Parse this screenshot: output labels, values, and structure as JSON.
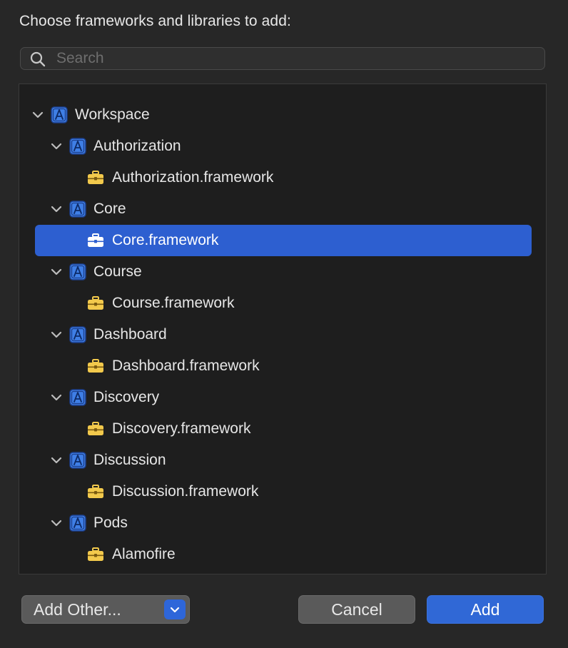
{
  "dialog": {
    "heading": "Choose frameworks and libraries to add:"
  },
  "search": {
    "placeholder": "Search",
    "value": ""
  },
  "tree": {
    "items": [
      {
        "label": "Workspace",
        "kind": "project",
        "level": 0,
        "expanded": true,
        "selected": false
      },
      {
        "label": "Authorization",
        "kind": "project",
        "level": 1,
        "expanded": true,
        "selected": false
      },
      {
        "label": "Authorization.framework",
        "kind": "framework",
        "level": 2,
        "selected": false
      },
      {
        "label": "Core",
        "kind": "project",
        "level": 1,
        "expanded": true,
        "selected": false
      },
      {
        "label": "Core.framework",
        "kind": "framework",
        "level": 2,
        "selected": true
      },
      {
        "label": "Course",
        "kind": "project",
        "level": 1,
        "expanded": true,
        "selected": false
      },
      {
        "label": "Course.framework",
        "kind": "framework",
        "level": 2,
        "selected": false
      },
      {
        "label": "Dashboard",
        "kind": "project",
        "level": 1,
        "expanded": true,
        "selected": false
      },
      {
        "label": "Dashboard.framework",
        "kind": "framework",
        "level": 2,
        "selected": false
      },
      {
        "label": "Discovery",
        "kind": "project",
        "level": 1,
        "expanded": true,
        "selected": false
      },
      {
        "label": "Discovery.framework",
        "kind": "framework",
        "level": 2,
        "selected": false
      },
      {
        "label": "Discussion",
        "kind": "project",
        "level": 1,
        "expanded": true,
        "selected": false
      },
      {
        "label": "Discussion.framework",
        "kind": "framework",
        "level": 2,
        "selected": false
      },
      {
        "label": "Pods",
        "kind": "project",
        "level": 1,
        "expanded": true,
        "selected": false
      },
      {
        "label": "Alamofire",
        "kind": "framework",
        "level": 2,
        "selected": false
      }
    ]
  },
  "buttons": {
    "add_other": "Add Other...",
    "cancel": "Cancel",
    "add": "Add"
  },
  "icons": {
    "search": "magnifier-icon",
    "project": "xcode-project-icon",
    "framework": "toolbox-icon",
    "chevron": "chevron-down-icon"
  },
  "colors": {
    "accent": "#2d5fd0",
    "project_icon": "#4a86e8",
    "framework_icon": "#f2c94c"
  }
}
